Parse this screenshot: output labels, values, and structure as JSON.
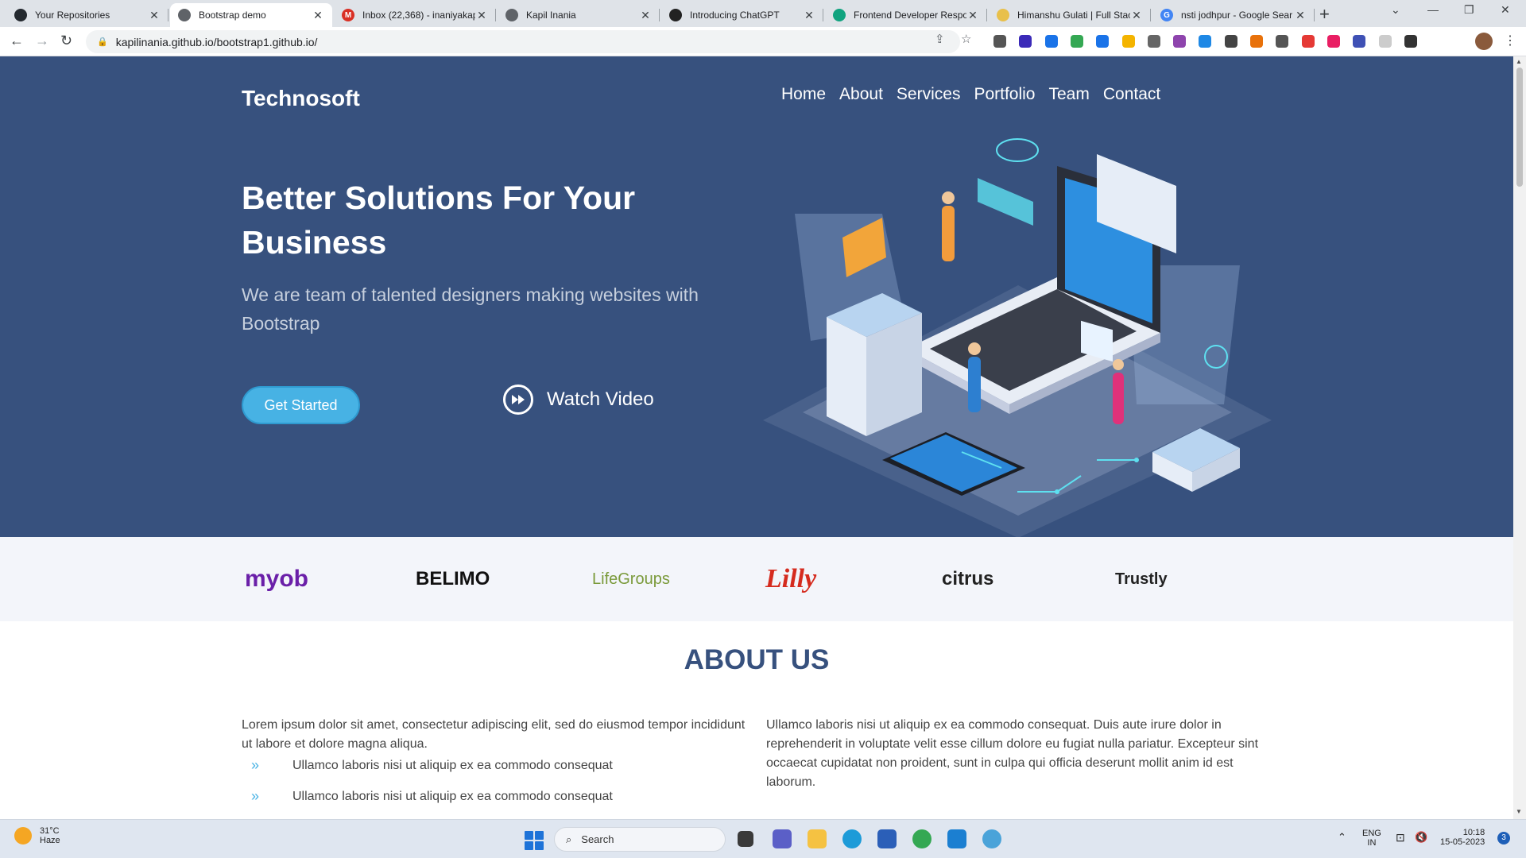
{
  "tabs": [
    {
      "title": "Your Repositories",
      "color": "#24292f",
      "glyph": ""
    },
    {
      "title": "Bootstrap demo",
      "color": "#5f6368",
      "glyph": "",
      "active": true
    },
    {
      "title": "Inbox (22,368) - inaniyakap",
      "color": "#d93025",
      "glyph": "M"
    },
    {
      "title": "Kapil Inania",
      "color": "#5f6368",
      "glyph": ""
    },
    {
      "title": "Introducing ChatGPT",
      "color": "#222",
      "glyph": ""
    },
    {
      "title": "Frontend Developer Respo",
      "color": "#10a37f",
      "glyph": ""
    },
    {
      "title": "Himanshu Gulati | Full Stac",
      "color": "#e8c04a",
      "glyph": ""
    },
    {
      "title": "nsti jodhpur - Google Sear",
      "color": "#4285f4",
      "glyph": "G"
    }
  ],
  "address": {
    "url": "kapilinania.github.io/bootstrap1.github.io/"
  },
  "site": {
    "brand": "Technosoft",
    "nav": [
      "Home",
      "About",
      "Services",
      "Portfolio",
      "Team",
      "Contact"
    ],
    "hero_title": "Better Solutions For Your Business",
    "hero_lead": "We are team of talented designers making websites with Bootstrap",
    "cta": "Get Started",
    "watch": "Watch Video",
    "clients": [
      {
        "name": "myob",
        "color": "#6a1fa8"
      },
      {
        "name": "BELIMO",
        "color": "#111"
      },
      {
        "name": "LifeGroups",
        "color": "#7a9a3a"
      },
      {
        "name": "Lilly",
        "color": "#d52b1e"
      },
      {
        "name": "citrus",
        "color": "#222"
      },
      {
        "name": "Trustly",
        "color": "#222"
      }
    ],
    "about_title": "ABOUT US",
    "about_left": "Lorem ipsum dolor sit amet, consectetur adipiscing elit, sed do eiusmod tempor incididunt ut labore et dolore magna aliqua.",
    "about_list": [
      "Ullamco laboris nisi ut aliquip ex ea commodo consequat",
      "Ullamco laboris nisi ut aliquip ex ea commodo consequat"
    ],
    "about_right": "Ullamco laboris nisi ut aliquip ex ea commodo consequat. Duis aute irure dolor in reprehenderit in voluptate velit esse cillum dolore eu fugiat nulla pariatur. Excepteur sint occaecat cupidatat non proident, sunt in culpa qui officia deserunt mollit anim id est laborum."
  },
  "taskbar": {
    "temp": "31°C",
    "weather": "Haze",
    "search": "Search",
    "lang1": "ENG",
    "lang2": "IN",
    "time": "10:18",
    "date": "15-05-2023",
    "notif": "3"
  },
  "colors": {
    "hero": "#37517e",
    "accent": "#47b2e4"
  }
}
